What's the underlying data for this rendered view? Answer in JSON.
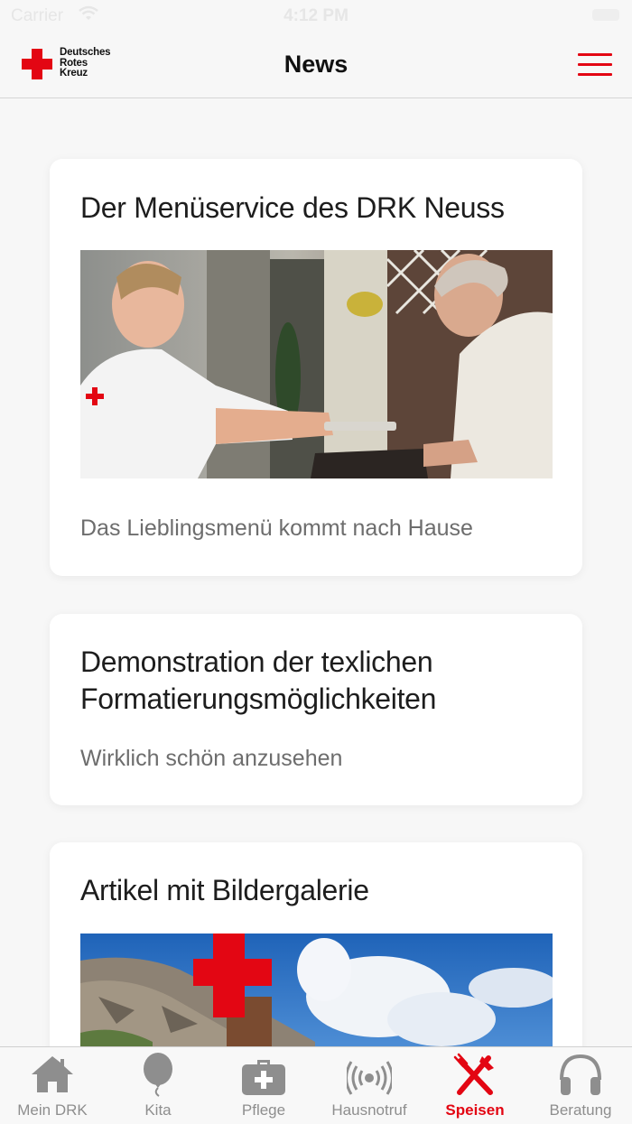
{
  "status_bar": {
    "carrier": "Carrier",
    "time": "4:12 PM"
  },
  "header": {
    "logo_lines": [
      "Deutsches",
      "Rotes",
      "Kreuz"
    ],
    "title": "News",
    "menu_icon": "hamburger-menu-icon"
  },
  "news": [
    {
      "title": "Der Menüservice des DRK Neuss",
      "subtitle": "Das Lieblingsmenü kommt nach Hause",
      "image": "meal-delivery-photo"
    },
    {
      "title": "Demonstration der texlichen Formatierungsmöglichkeiten",
      "subtitle": "Wirklich schön anzusehen"
    },
    {
      "title": "Artikel mit Bildergalerie",
      "image": "mountain-cross-photo"
    }
  ],
  "tabs": [
    {
      "label": "Mein DRK",
      "icon": "home-icon"
    },
    {
      "label": "Kita",
      "icon": "balloon-icon"
    },
    {
      "label": "Pflege",
      "icon": "first-aid-kit-icon"
    },
    {
      "label": "Hausnotruf",
      "icon": "signal-icon"
    },
    {
      "label": "Speisen",
      "icon": "fork-knife-icon",
      "active": true
    },
    {
      "label": "Beratung",
      "icon": "headphones-icon"
    }
  ],
  "colors": {
    "accent": "#e30613",
    "tab_inactive": "#8e8e8e",
    "background": "#f7f7f7"
  }
}
